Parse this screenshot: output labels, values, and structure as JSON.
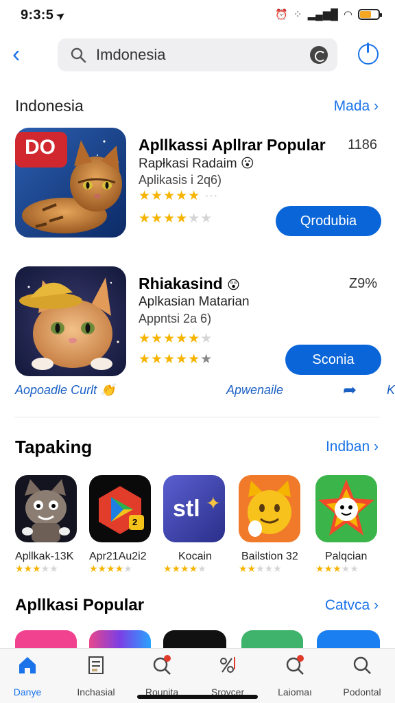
{
  "status": {
    "time": "9:3:5",
    "battery_color": "#f5a623"
  },
  "search": {
    "value": "Imdonesia"
  },
  "section1": {
    "title": "Indonesia",
    "link": "Mada"
  },
  "featured": [
    {
      "title": "Apllkassi Apllrar Popular",
      "subtitle": "Rapłkasi Radaim",
      "subtitle2": "Aplikasis i 2q6)",
      "meta": "1186",
      "button": "Qrodubia",
      "badge": "DO",
      "rating1": 4,
      "rating2": 3.5
    },
    {
      "title": "Rhiakasind",
      "subtitle": "Aplkasian Matarian",
      "subtitle2": "Appntsi 2a 6)",
      "meta": "Z9%",
      "button": "Sconia",
      "rating1": 4.5,
      "rating2": 5
    }
  ],
  "promo": {
    "left": "Aopoadle Curlt",
    "center": "Apwenaile",
    "right": "K"
  },
  "section2": {
    "title": "Tapaking",
    "link": "Indban"
  },
  "strip": [
    {
      "name": "Apllkak-13K",
      "rating": 3
    },
    {
      "name": "Apr21Au2i2",
      "rating": 3.5,
      "badge": "2"
    },
    {
      "name": "Kocain",
      "rating": 4.5,
      "logo": "stl"
    },
    {
      "name": "Bailstion 32",
      "rating": 2.5
    },
    {
      "name": "Palqcian",
      "rating": 3
    }
  ],
  "section3": {
    "title": "Apllkasi Popular",
    "link": "Catvca"
  },
  "tabs": [
    {
      "label": "Danye",
      "icon": "home-icon",
      "active": true
    },
    {
      "label": "Inchasial",
      "icon": "document-icon"
    },
    {
      "label": "Rounita",
      "icon": "search-badge-icon"
    },
    {
      "label": "Srovcer",
      "icon": "percent-icon"
    },
    {
      "label": "Laiomaı",
      "icon": "search-badge-icon"
    },
    {
      "label": "Podontal",
      "icon": "search-icon"
    }
  ],
  "colors": {
    "accent": "#1a73e8",
    "button": "#0a66d8",
    "star": "#f6b400"
  }
}
